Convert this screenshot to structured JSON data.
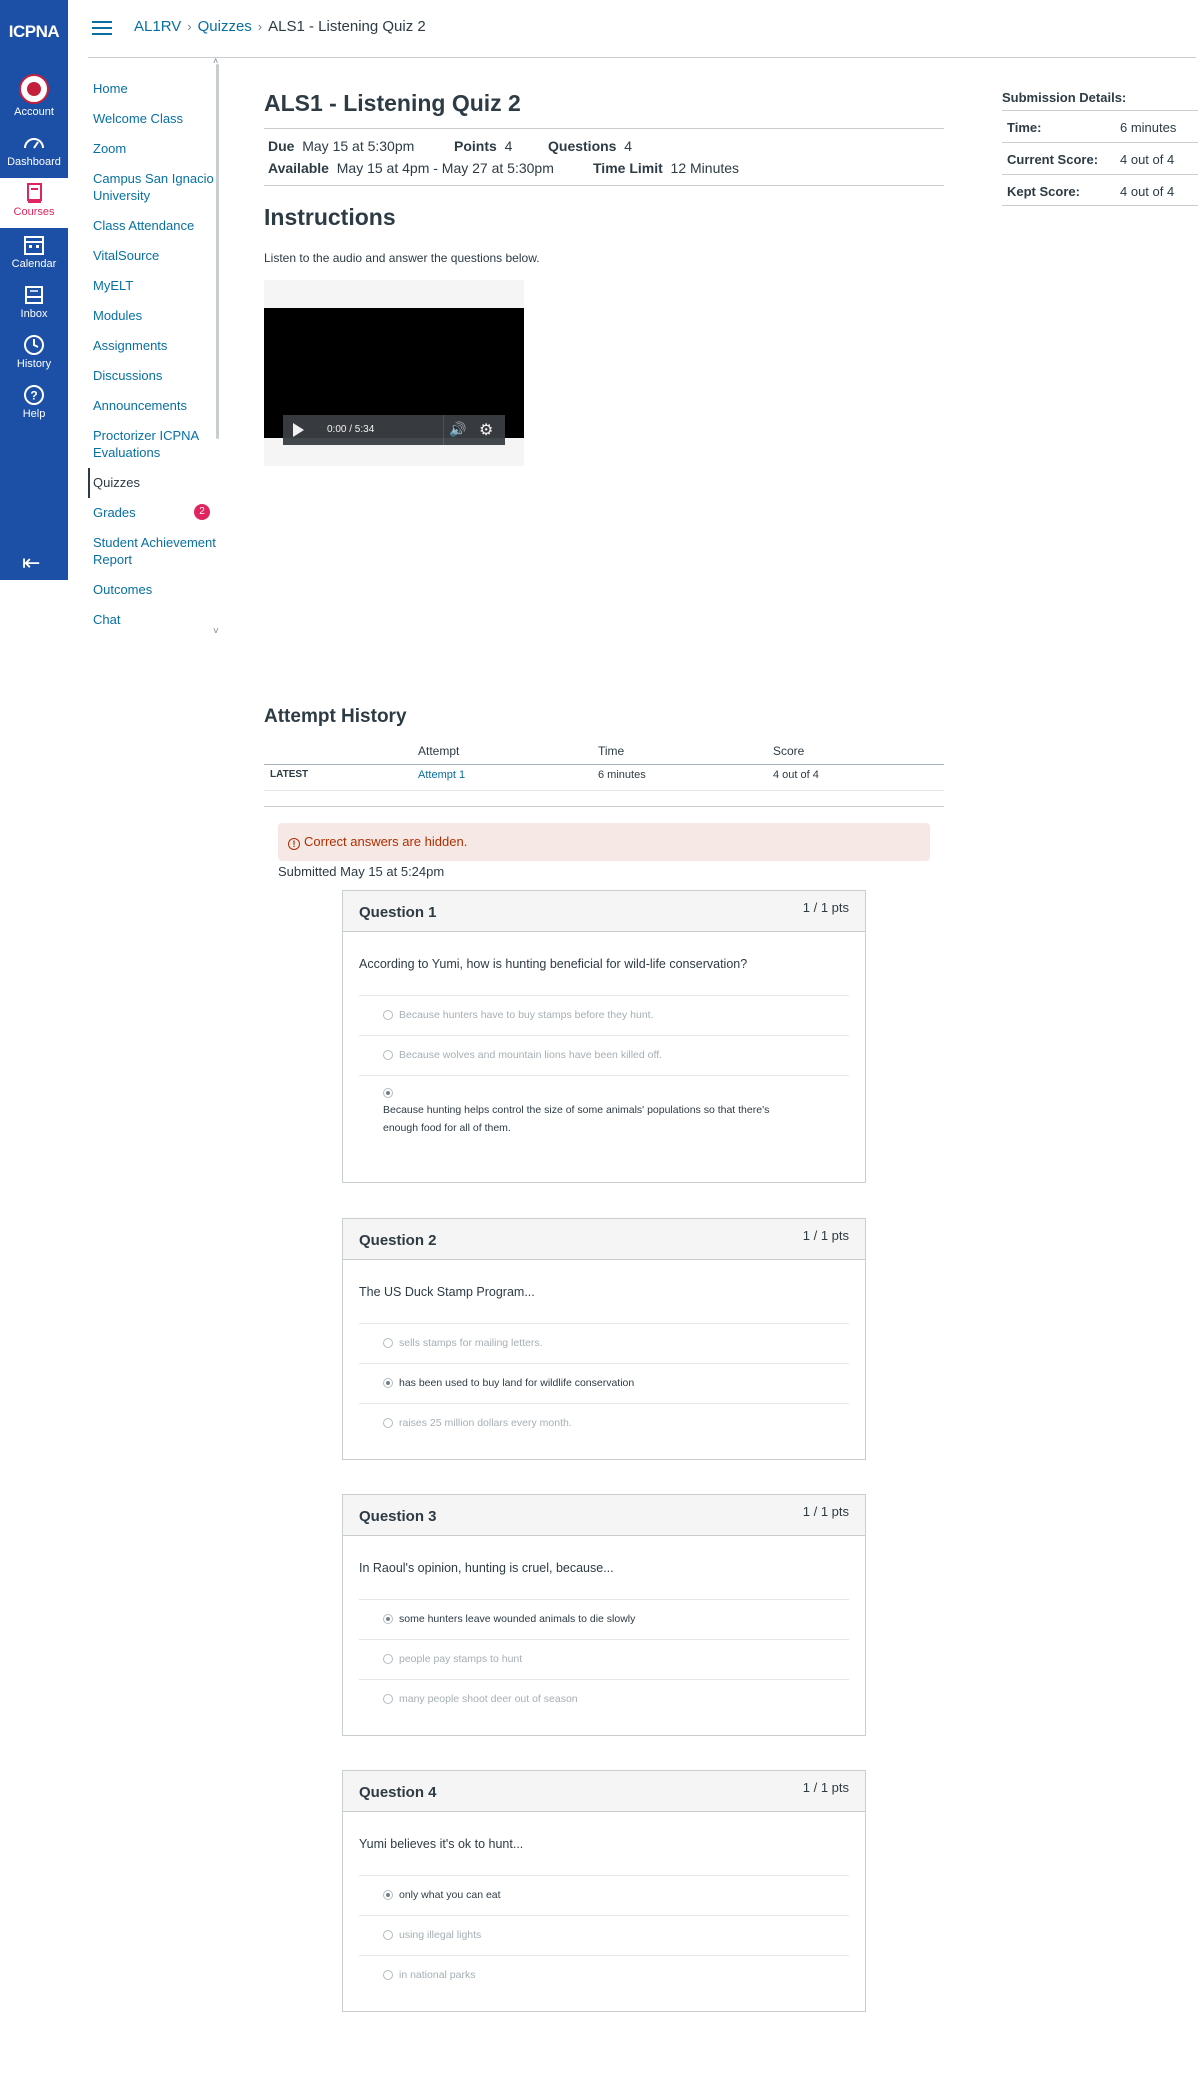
{
  "global_nav": {
    "logo": "ICPNA",
    "items": [
      {
        "label": "Account",
        "icon": "account-avatar"
      },
      {
        "label": "Dashboard",
        "icon": "dashboard-icon"
      },
      {
        "label": "Courses",
        "icon": "courses-icon"
      },
      {
        "label": "Calendar",
        "icon": "calendar-icon"
      },
      {
        "label": "Inbox",
        "icon": "inbox-icon"
      },
      {
        "label": "History",
        "icon": "history-icon"
      },
      {
        "label": "Help",
        "icon": "help-icon"
      }
    ],
    "active_color": "#e0245e",
    "bg_color": "#1c4fa6"
  },
  "breadcrumb": {
    "course": "AL1RV",
    "section": "Quizzes",
    "current": "ALS1 - Listening Quiz 2"
  },
  "course_nav": {
    "items": [
      "Home",
      "Welcome Class",
      "Zoom",
      "Campus San Ignacio University",
      "Class Attendance",
      "VitalSource",
      "MyELT",
      "Modules",
      "Assignments",
      "Discussions",
      "Announcements",
      "Proctorizer ICPNA Evaluations",
      "Quizzes",
      "Grades",
      "Student Achievement Report",
      "Outcomes",
      "Chat"
    ],
    "active": "Quizzes",
    "grades_badge": "2"
  },
  "quiz": {
    "title": "ALS1 - Listening Quiz 2",
    "due_label": "Due",
    "due_value": "May 15 at 5:30pm",
    "points_label": "Points",
    "points_value": "4",
    "questions_label": "Questions",
    "questions_value": "4",
    "available_label": "Available",
    "available_value": "May 15 at 4pm - May 27 at 5:30pm",
    "time_limit_label": "Time Limit",
    "time_limit_value": "12 Minutes",
    "instructions_title": "Instructions",
    "instructions_text": "Listen to the audio and answer the questions below.",
    "video_time": "0:00 / 5:34"
  },
  "attempt_history": {
    "title": "Attempt History",
    "headers": [
      "Attempt",
      "Time",
      "Score"
    ],
    "row": {
      "tag": "LATEST",
      "attempt": "Attempt 1",
      "time": "6 minutes",
      "score": "4 out of 4"
    }
  },
  "alert": "Correct answers are hidden.",
  "submitted": "Submitted May 15 at 5:24pm",
  "questions": [
    {
      "name": "Question 1",
      "pts": "1 / 1 pts",
      "text": "According to Yumi, how is hunting beneficial for wild-life conservation?",
      "answers": [
        "Because hunters have to buy stamps before they hunt.",
        "Because wolves and mountain lions have been killed off.",
        "Because hunting helps control the size of some animals' populations so that there's",
        "enough food for all of them."
      ],
      "selected": 2
    },
    {
      "name": "Question 2",
      "pts": "1 / 1 pts",
      "text": "The US Duck Stamp Program...",
      "answers": [
        "sells stamps for mailing letters.",
        "has been used to buy land for wildlife conservation",
        "raises 25 million dollars every month."
      ],
      "selected": 1
    },
    {
      "name": "Question 3",
      "pts": "1 / 1 pts",
      "text": "In Raoul's opinion, hunting is cruel, because...",
      "answers": [
        "some hunters leave wounded animals to die slowly",
        "people pay stamps to hunt",
        "many people shoot deer out of season"
      ],
      "selected": 0
    },
    {
      "name": "Question 4",
      "pts": "1 / 1 pts",
      "text": "Yumi believes it's ok to hunt...",
      "answers": [
        "only what you can eat",
        "using illegal lights",
        "in national parks"
      ],
      "selected": 0
    }
  ],
  "submission_details": {
    "title": "Submission Details:",
    "rows": [
      {
        "label": "Time:",
        "value": "6 minutes"
      },
      {
        "label": "Current Score:",
        "value": "4 out of 4"
      },
      {
        "label": "Kept Score:",
        "value": "4 out of 4"
      }
    ]
  }
}
